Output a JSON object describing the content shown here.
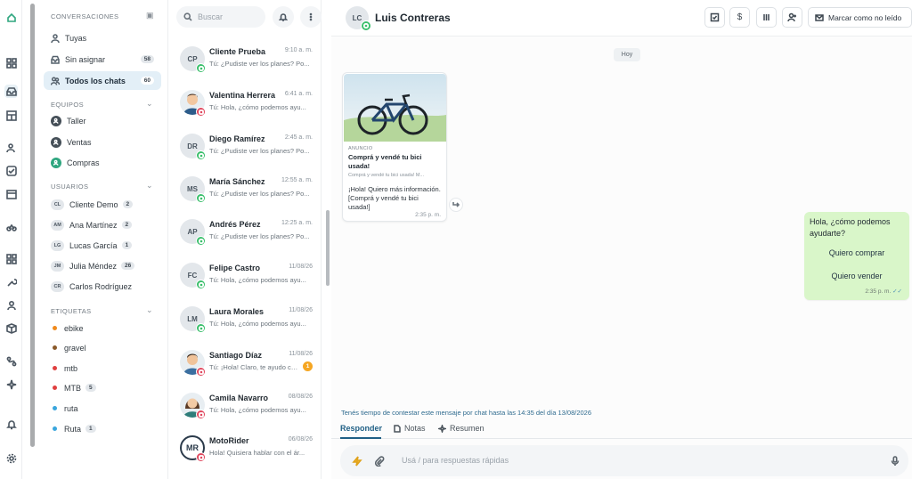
{
  "sidebar": {
    "conversations_title": "CONVERSACIONES",
    "items": [
      {
        "label": "Tuyas",
        "count": ""
      },
      {
        "label": "Sin asignar",
        "count": "58"
      },
      {
        "label": "Todos los chats",
        "count": "60"
      }
    ],
    "teams_title": "EQUIPOS",
    "teams": [
      {
        "label": "Taller"
      },
      {
        "label": "Ventas"
      },
      {
        "label": "Compras"
      }
    ],
    "users_title": "USUARIOS",
    "users": [
      {
        "initials": "CL",
        "label": "Cliente Demo",
        "count": "2"
      },
      {
        "initials": "AM",
        "label": "Ana Martínez",
        "count": "2"
      },
      {
        "initials": "LG",
        "label": "Lucas García",
        "count": "1"
      },
      {
        "initials": "JM",
        "label": "Julia Méndez",
        "count": "26"
      },
      {
        "initials": "CR",
        "label": "Carlos Rodríguez",
        "count": ""
      }
    ],
    "tags_title": "ETIQUETAS",
    "tags": [
      {
        "label": "ebike",
        "count": "",
        "color": "#f08a1c"
      },
      {
        "label": "gravel",
        "count": "",
        "color": "#8a5a2b"
      },
      {
        "label": "mtb",
        "count": "",
        "color": "#e04040"
      },
      {
        "label": "MTB",
        "count": "5",
        "color": "#e04040"
      },
      {
        "label": "ruta",
        "count": "",
        "color": "#3aa6dd"
      },
      {
        "label": "Ruta",
        "count": "1",
        "color": "#3aa6dd"
      }
    ]
  },
  "chatlist": {
    "search_placeholder": "Buscar",
    "chats": [
      {
        "initials": "CP",
        "name": "Cliente Prueba",
        "time": "9:10 a. m.",
        "preview": "Tú: ¿Pudiste ver los planes? Po...",
        "channel": "whatsapp",
        "badge": ""
      },
      {
        "initials": "",
        "name": "Valentina Herrera",
        "time": "6:41 a. m.",
        "preview": "Tú: Hola, ¿cómo podemos ayu...",
        "channel": "instagram",
        "badge": ""
      },
      {
        "initials": "DR",
        "name": "Diego Ramírez",
        "time": "2:45 a. m.",
        "preview": "Tú: ¿Pudiste ver los planes? Po...",
        "channel": "whatsapp",
        "badge": ""
      },
      {
        "initials": "MS",
        "name": "María Sánchez",
        "time": "12:55 a. m.",
        "preview": "Tú: ¿Pudiste ver los planes? Po...",
        "channel": "whatsapp",
        "badge": ""
      },
      {
        "initials": "AP",
        "name": "Andrés Pérez",
        "time": "12:25 a. m.",
        "preview": "Tú: ¿Pudiste ver los planes? Po...",
        "channel": "whatsapp",
        "badge": ""
      },
      {
        "initials": "FC",
        "name": "Felipe Castro",
        "time": "11/08/26",
        "preview": "Tú: Hola, ¿cómo podemos ayu...",
        "channel": "whatsapp",
        "badge": ""
      },
      {
        "initials": "LM",
        "name": "Laura Morales",
        "time": "11/08/26",
        "preview": "Tú: Hola, ¿cómo podemos ayu...",
        "channel": "whatsapp",
        "badge": ""
      },
      {
        "initials": "",
        "name": "Santiago Díaz",
        "time": "11/08/26",
        "preview": "Tú: ¡Hola! Claro, te ayudo con ...",
        "channel": "instagram",
        "badge": "1"
      },
      {
        "initials": "",
        "name": "Camila Navarro",
        "time": "08/08/26",
        "preview": "Tú: Hola, ¿cómo podemos ayu...",
        "channel": "instagram",
        "badge": ""
      },
      {
        "initials": "MR",
        "name": "MotoRider",
        "time": "06/08/26",
        "preview": "Hola! Quisiera hablar con el ár...",
        "channel": "instagram",
        "badge": ""
      }
    ]
  },
  "conversation": {
    "contact_initials": "LC",
    "contact_name": "Luis Contreras",
    "mark_unread_label": "Marcar como no leído",
    "date_chip": "Hoy",
    "ad": {
      "label": "ANUNCIO",
      "title": "Comprá y vendé tu bici usada!",
      "subtitle": "Comprá y vendé tu bici usada! M...",
      "message": "¡Hola! Quiero más información. [Comprá y vendé tu bici usada!]",
      "time": "2:35 p. m."
    },
    "outgoing": {
      "text": "Hola, ¿cómo podemos ayudarte?",
      "quick_replies": [
        "Quiero comprar",
        "Quiero vender"
      ],
      "time": "2:35 p. m."
    },
    "reply_window": "Tenés tiempo de contestar este mensaje por chat hasta las 14:35 del día 13/08/2026",
    "tabs": [
      "Responder",
      "Notas",
      "Resumen"
    ],
    "composer_placeholder": "Usá / para respuestas rápidas"
  },
  "colors": {
    "accent": "#1f5f85",
    "whatsapp": "#3bbf6c",
    "instagram": "#e0475e",
    "outgoing_bubble": "#d9f6c9"
  }
}
